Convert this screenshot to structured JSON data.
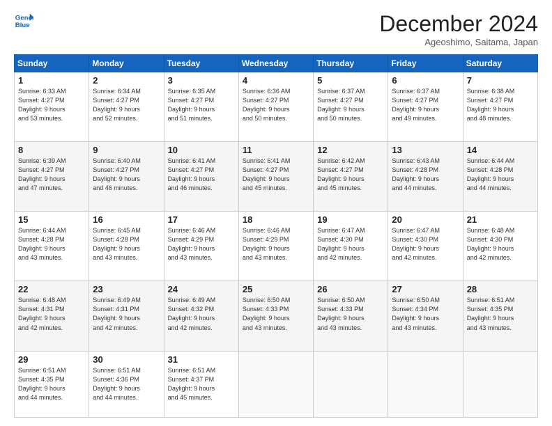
{
  "header": {
    "logo_line1": "General",
    "logo_line2": "Blue",
    "month": "December 2024",
    "location": "Ageoshimo, Saitama, Japan"
  },
  "weekdays": [
    "Sunday",
    "Monday",
    "Tuesday",
    "Wednesday",
    "Thursday",
    "Friday",
    "Saturday"
  ],
  "weeks": [
    [
      {
        "day": "1",
        "info": "Sunrise: 6:33 AM\nSunset: 4:27 PM\nDaylight: 9 hours\nand 53 minutes."
      },
      {
        "day": "2",
        "info": "Sunrise: 6:34 AM\nSunset: 4:27 PM\nDaylight: 9 hours\nand 52 minutes."
      },
      {
        "day": "3",
        "info": "Sunrise: 6:35 AM\nSunset: 4:27 PM\nDaylight: 9 hours\nand 51 minutes."
      },
      {
        "day": "4",
        "info": "Sunrise: 6:36 AM\nSunset: 4:27 PM\nDaylight: 9 hours\nand 50 minutes."
      },
      {
        "day": "5",
        "info": "Sunrise: 6:37 AM\nSunset: 4:27 PM\nDaylight: 9 hours\nand 50 minutes."
      },
      {
        "day": "6",
        "info": "Sunrise: 6:37 AM\nSunset: 4:27 PM\nDaylight: 9 hours\nand 49 minutes."
      },
      {
        "day": "7",
        "info": "Sunrise: 6:38 AM\nSunset: 4:27 PM\nDaylight: 9 hours\nand 48 minutes."
      }
    ],
    [
      {
        "day": "8",
        "info": "Sunrise: 6:39 AM\nSunset: 4:27 PM\nDaylight: 9 hours\nand 47 minutes."
      },
      {
        "day": "9",
        "info": "Sunrise: 6:40 AM\nSunset: 4:27 PM\nDaylight: 9 hours\nand 46 minutes."
      },
      {
        "day": "10",
        "info": "Sunrise: 6:41 AM\nSunset: 4:27 PM\nDaylight: 9 hours\nand 46 minutes."
      },
      {
        "day": "11",
        "info": "Sunrise: 6:41 AM\nSunset: 4:27 PM\nDaylight: 9 hours\nand 45 minutes."
      },
      {
        "day": "12",
        "info": "Sunrise: 6:42 AM\nSunset: 4:27 PM\nDaylight: 9 hours\nand 45 minutes."
      },
      {
        "day": "13",
        "info": "Sunrise: 6:43 AM\nSunset: 4:28 PM\nDaylight: 9 hours\nand 44 minutes."
      },
      {
        "day": "14",
        "info": "Sunrise: 6:44 AM\nSunset: 4:28 PM\nDaylight: 9 hours\nand 44 minutes."
      }
    ],
    [
      {
        "day": "15",
        "info": "Sunrise: 6:44 AM\nSunset: 4:28 PM\nDaylight: 9 hours\nand 43 minutes."
      },
      {
        "day": "16",
        "info": "Sunrise: 6:45 AM\nSunset: 4:28 PM\nDaylight: 9 hours\nand 43 minutes."
      },
      {
        "day": "17",
        "info": "Sunrise: 6:46 AM\nSunset: 4:29 PM\nDaylight: 9 hours\nand 43 minutes."
      },
      {
        "day": "18",
        "info": "Sunrise: 6:46 AM\nSunset: 4:29 PM\nDaylight: 9 hours\nand 43 minutes."
      },
      {
        "day": "19",
        "info": "Sunrise: 6:47 AM\nSunset: 4:30 PM\nDaylight: 9 hours\nand 42 minutes."
      },
      {
        "day": "20",
        "info": "Sunrise: 6:47 AM\nSunset: 4:30 PM\nDaylight: 9 hours\nand 42 minutes."
      },
      {
        "day": "21",
        "info": "Sunrise: 6:48 AM\nSunset: 4:30 PM\nDaylight: 9 hours\nand 42 minutes."
      }
    ],
    [
      {
        "day": "22",
        "info": "Sunrise: 6:48 AM\nSunset: 4:31 PM\nDaylight: 9 hours\nand 42 minutes."
      },
      {
        "day": "23",
        "info": "Sunrise: 6:49 AM\nSunset: 4:31 PM\nDaylight: 9 hours\nand 42 minutes."
      },
      {
        "day": "24",
        "info": "Sunrise: 6:49 AM\nSunset: 4:32 PM\nDaylight: 9 hours\nand 42 minutes."
      },
      {
        "day": "25",
        "info": "Sunrise: 6:50 AM\nSunset: 4:33 PM\nDaylight: 9 hours\nand 43 minutes."
      },
      {
        "day": "26",
        "info": "Sunrise: 6:50 AM\nSunset: 4:33 PM\nDaylight: 9 hours\nand 43 minutes."
      },
      {
        "day": "27",
        "info": "Sunrise: 6:50 AM\nSunset: 4:34 PM\nDaylight: 9 hours\nand 43 minutes."
      },
      {
        "day": "28",
        "info": "Sunrise: 6:51 AM\nSunset: 4:35 PM\nDaylight: 9 hours\nand 43 minutes."
      }
    ],
    [
      {
        "day": "29",
        "info": "Sunrise: 6:51 AM\nSunset: 4:35 PM\nDaylight: 9 hours\nand 44 minutes."
      },
      {
        "day": "30",
        "info": "Sunrise: 6:51 AM\nSunset: 4:36 PM\nDaylight: 9 hours\nand 44 minutes."
      },
      {
        "day": "31",
        "info": "Sunrise: 6:51 AM\nSunset: 4:37 PM\nDaylight: 9 hours\nand 45 minutes."
      },
      {
        "day": "",
        "info": ""
      },
      {
        "day": "",
        "info": ""
      },
      {
        "day": "",
        "info": ""
      },
      {
        "day": "",
        "info": ""
      }
    ]
  ]
}
